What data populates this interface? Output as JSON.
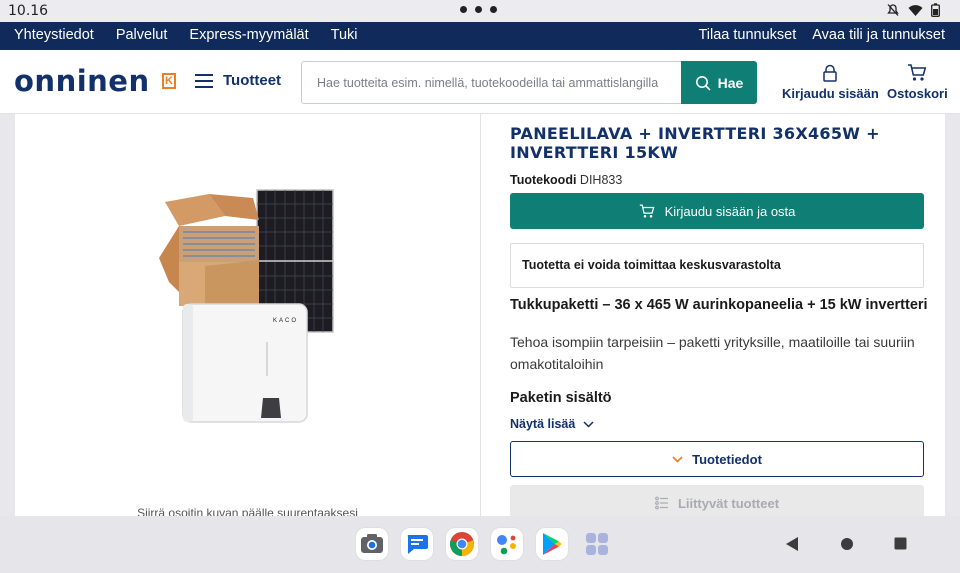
{
  "status_bar": {
    "time": "10.16"
  },
  "top_nav": {
    "left": [
      "Yhteystiedot",
      "Palvelut",
      "Express-myymälät",
      "Tuki"
    ],
    "right": [
      "Tilaa tunnukset",
      "Avaa tili ja tunnukset"
    ]
  },
  "header": {
    "logo": "onninen",
    "logo_badge": "K",
    "menu_label": "Tuotteet",
    "search_placeholder": "Hae tuotteita esim. nimellä, tuotekoodeilla tai ammattislangilla",
    "search_button": "Hae",
    "login_label": "Kirjaudu sisään",
    "cart_label": "Ostoskori"
  },
  "product": {
    "title": "PANEELILAVA + INVERTTERI 36X465W + INVERTTERI 15KW",
    "code_label": "Tuotekoodi",
    "code_value": "DIH833",
    "buy_button": "Kirjaudu sisään ja osta",
    "notice": "Tuotetta ei voida toimittaa keskusvarastolta",
    "subheading": "Tukkupaketti – 36 x 465 W aurinkopaneelia + 15 kW invertteri",
    "description": "Tehoa isompiin tarpeisiin – paketti yrityksille, maatiloille tai suuriin omakotitaloihin",
    "package_heading": "Paketin sisältö",
    "show_more": "Näytä lisää",
    "details_button": "Tuotetiedot",
    "related_button": "Liittyvät tuotteet",
    "zoom_hint": "Siirrä osoitin kuvan päälle suurentaaksesi",
    "inverter_brand": "KACO"
  },
  "colors": {
    "navy": "#102a5b",
    "teal": "#0f7e74",
    "orange": "#f07c1e"
  },
  "dock_apps": [
    "camera-icon",
    "messages-icon",
    "chrome-icon",
    "assistant-icon",
    "play-store-icon",
    "app-drawer-icon"
  ]
}
